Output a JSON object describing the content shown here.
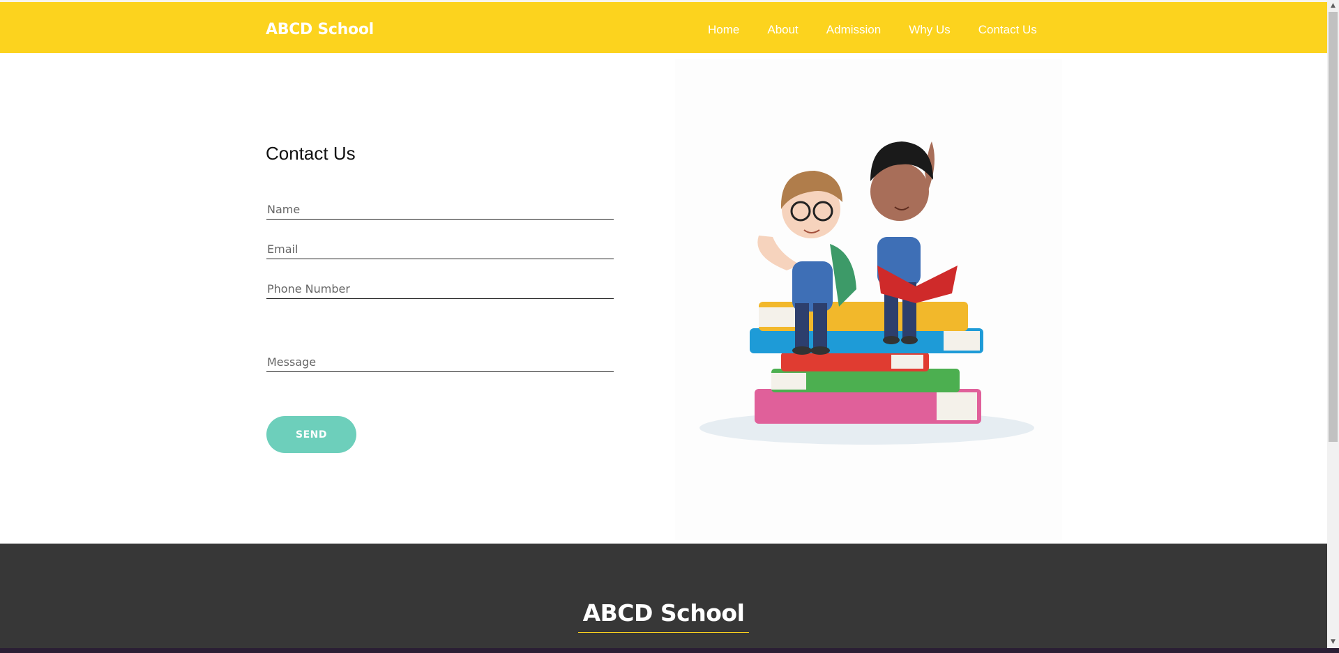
{
  "header": {
    "brand": "ABCD School",
    "nav": [
      "Home",
      "About",
      "Admission",
      "Why Us",
      "Contact Us"
    ]
  },
  "contact": {
    "title": "Contact Us",
    "fields": {
      "name_placeholder": "Name",
      "email_placeholder": "Email",
      "phone_placeholder": "Phone Number",
      "message_placeholder": "Message"
    },
    "send_label": "SEND"
  },
  "footer": {
    "brand": "ABCD School"
  },
  "colors": {
    "accent": "#fcd31e",
    "button": "#6dcfbb",
    "footer": "#373737"
  }
}
